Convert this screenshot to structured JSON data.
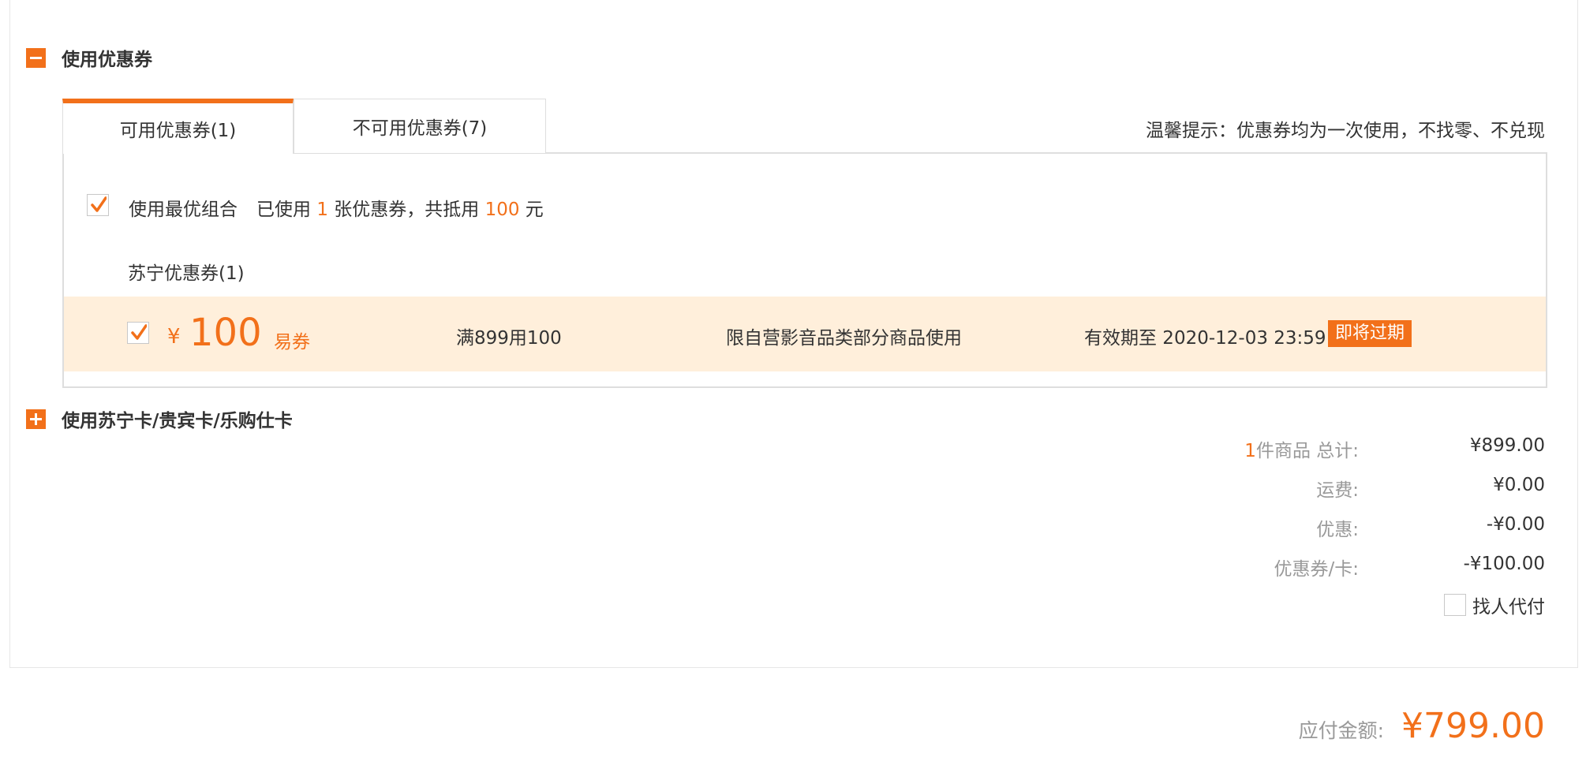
{
  "coupon_section": {
    "title": "使用优惠券",
    "tabs": [
      {
        "label": "可用优惠券(1)",
        "active": true
      },
      {
        "label": "不可用优惠券(7)",
        "active": false
      }
    ],
    "hint": "温馨提示：优惠券均为一次使用，不找零、不兑现",
    "best_combo": {
      "label": "使用最优组合",
      "checked": true,
      "used_prefix": "已使用",
      "used_count": "1",
      "used_mid": "张优惠券，共抵用",
      "deduct_amount": "100",
      "used_suffix": "元"
    },
    "group_title": "苏宁优惠券(1)",
    "coupon": {
      "checked": true,
      "currency": "¥",
      "amount": "100",
      "kind": "易券",
      "condition": "满899用100",
      "scope": "限自营影音品类部分商品使用",
      "expiry": "有效期至 2020-12-03 23:59",
      "badge": "即将过期"
    }
  },
  "card_section": {
    "title": "使用苏宁卡/贵宾卡/乐购仕卡"
  },
  "summary": {
    "items_count": "1",
    "items_label": "件商品 总计:",
    "items_total": "¥899.00",
    "shipping_label": "运费:",
    "shipping_value": "¥0.00",
    "discount_label": "优惠:",
    "discount_value": "-¥0.00",
    "coupon_label": "优惠券/卡:",
    "coupon_value": "-¥100.00",
    "proxy_pay_label": "找人代付"
  },
  "payable": {
    "label": "应付金额:",
    "value": "¥799.00"
  },
  "colors": {
    "accent": "#f2701a",
    "coupon_bg": "#ffefdb"
  }
}
